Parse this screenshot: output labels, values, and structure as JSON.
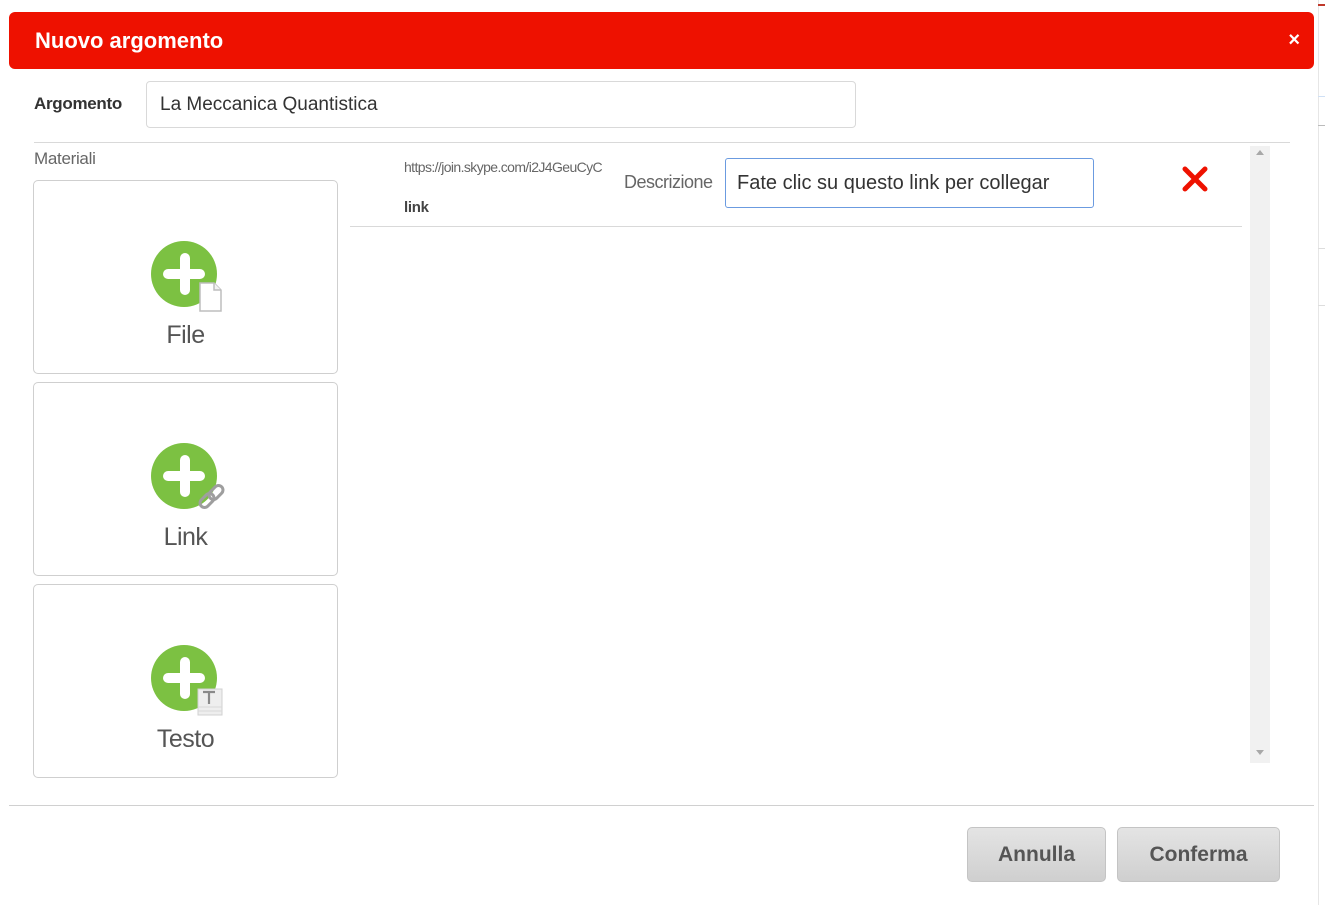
{
  "modal": {
    "title": "Nuovo argomento",
    "close_glyph": "×",
    "header_color": "#ee1100"
  },
  "argomento": {
    "label": "Argomento",
    "value": "La Meccanica Quantistica"
  },
  "materiali": {
    "label": "Materiali",
    "tiles": [
      {
        "label": "File",
        "icon": "add-file-icon"
      },
      {
        "label": "Link",
        "icon": "add-link-icon"
      },
      {
        "label": "Testo",
        "icon": "add-text-icon"
      }
    ],
    "accent_color": "#7cc142"
  },
  "items": [
    {
      "url": "https://join.skype.com/i2J4GeuCyC",
      "type": "link",
      "description_label": "Descrizione",
      "description_value": "Fate clic su questo link per collegar",
      "remove_icon": "remove-x-icon"
    }
  ],
  "footer": {
    "cancel_label": "Annulla",
    "confirm_label": "Conferma"
  }
}
